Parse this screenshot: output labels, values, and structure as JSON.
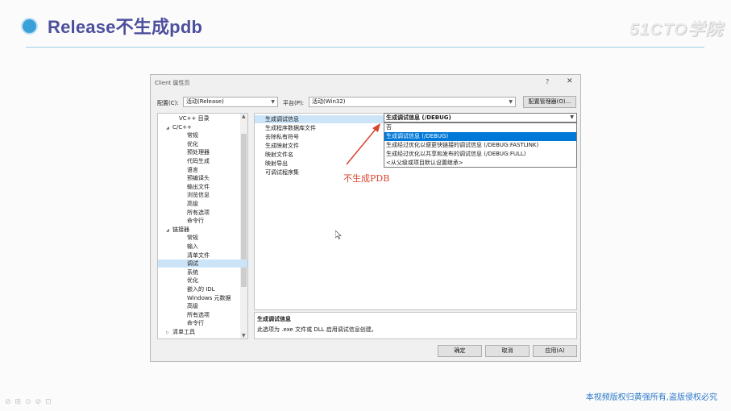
{
  "slide": {
    "title": "Release不生成pdb",
    "logo": "51CTO学院",
    "copyright": "本视频版权归黄强所有,盗版侵权必究",
    "bottom_tools": [
      "⊘",
      "⊞",
      "⊙",
      "⊘",
      "⊡"
    ]
  },
  "dialog": {
    "title": "Client 属性页",
    "help": "?",
    "close": "✕",
    "config_label": "配置(C):",
    "config_value": "活动(Release)",
    "platform_label": "平台(P):",
    "platform_value": "活动(Win32)",
    "config_manager_button": "配置管理器(O)...",
    "tree": [
      {
        "label": "VC++ 目录",
        "level": 1,
        "arrow": ""
      },
      {
        "label": "C/C++",
        "level": 0,
        "arrow": "◢"
      },
      {
        "label": "常规",
        "level": 2,
        "arrow": ""
      },
      {
        "label": "优化",
        "level": 2,
        "arrow": ""
      },
      {
        "label": "预处理器",
        "level": 2,
        "arrow": ""
      },
      {
        "label": "代码生成",
        "level": 2,
        "arrow": ""
      },
      {
        "label": "语言",
        "level": 2,
        "arrow": ""
      },
      {
        "label": "预编译头",
        "level": 2,
        "arrow": ""
      },
      {
        "label": "输出文件",
        "level": 2,
        "arrow": ""
      },
      {
        "label": "浏览信息",
        "level": 2,
        "arrow": ""
      },
      {
        "label": "高级",
        "level": 2,
        "arrow": ""
      },
      {
        "label": "所有选项",
        "level": 2,
        "arrow": ""
      },
      {
        "label": "命令行",
        "level": 2,
        "arrow": ""
      },
      {
        "label": "链接器",
        "level": 0,
        "arrow": "◢"
      },
      {
        "label": "常规",
        "level": 2,
        "arrow": ""
      },
      {
        "label": "输入",
        "level": 2,
        "arrow": ""
      },
      {
        "label": "清单文件",
        "level": 2,
        "arrow": ""
      },
      {
        "label": "调试",
        "level": 2,
        "arrow": "",
        "selected": true
      },
      {
        "label": "系统",
        "level": 2,
        "arrow": ""
      },
      {
        "label": "优化",
        "level": 2,
        "arrow": ""
      },
      {
        "label": "嵌入的 IDL",
        "level": 2,
        "arrow": ""
      },
      {
        "label": "Windows 元数据",
        "level": 2,
        "arrow": ""
      },
      {
        "label": "高级",
        "level": 2,
        "arrow": ""
      },
      {
        "label": "所有选项",
        "level": 2,
        "arrow": ""
      },
      {
        "label": "命令行",
        "level": 2,
        "arrow": ""
      },
      {
        "label": "清单工具",
        "level": 0,
        "arrow": "▷"
      }
    ],
    "properties": [
      {
        "label": "生成调试信息",
        "selected": true
      },
      {
        "label": "生成程序数据库文件"
      },
      {
        "label": "去除私有符号"
      },
      {
        "label": "生成映射文件"
      },
      {
        "label": "映射文件名"
      },
      {
        "label": "映射导出"
      },
      {
        "label": "可调试程序集"
      }
    ],
    "selected_value": "生成调试信息 (/DEBUG)",
    "dropdown_options": [
      {
        "label": "否"
      },
      {
        "label": "生成调试信息 (/DEBUG)",
        "highlighted": true
      },
      {
        "label": "生成经过优化以便更快链接的调试信息 (/DEBUG:FASTLINK)"
      },
      {
        "label": "生成经过优化以共享和发布的调试信息 (/DEBUG:FULL)"
      },
      {
        "label": "<从父级或项目默认设置继承>"
      }
    ],
    "description_title": "生成调试信息",
    "description_body": "此选项为 .exe 文件或 DLL 启用调试信息创建。",
    "ok_button": "确定",
    "cancel_button": "取消",
    "apply_button": "应用(A)"
  },
  "annotation": "不生成PDB",
  "colors": {
    "title": "#4d4f9e",
    "accent_dot": "#3aa0d8",
    "selection_blue": "#0078d7",
    "annotation_red": "#d9462e",
    "copyright_blue": "#2b78c9"
  }
}
